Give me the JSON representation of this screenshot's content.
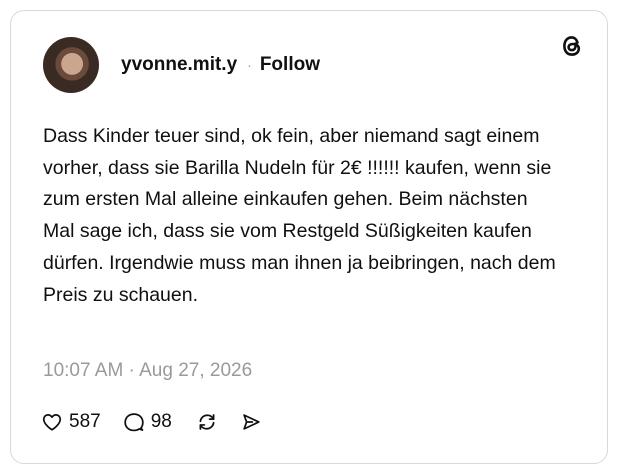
{
  "post": {
    "username": "yvonne.mit.y",
    "separator": "·",
    "follow_label": "Follow",
    "text": "Dass Kinder teuer sind, ok fein, aber niemand sagt einem vorher, dass sie Barilla Nudeln für 2€ !!!!!! kaufen, wenn sie zum ersten Mal alleine einkaufen gehen. Beim nächsten Mal sage ich, dass sie vom Restgeld Süßigkeiten kaufen dürfen. Irgendwie muss man ihnen ja beibringen, nach dem Preis zu schauen.",
    "timestamp": "10:07 AM · Aug 27, 2026"
  },
  "actions": {
    "like_count": "587",
    "comment_count": "98"
  },
  "icons": {
    "logo": "threads-logo-icon",
    "like": "heart-icon",
    "comment": "comment-bubble-icon",
    "repost": "repost-icon",
    "share": "send-icon"
  },
  "colors": {
    "text": "#101010",
    "muted": "#9a9a9a",
    "border": "#d9d9d9"
  }
}
